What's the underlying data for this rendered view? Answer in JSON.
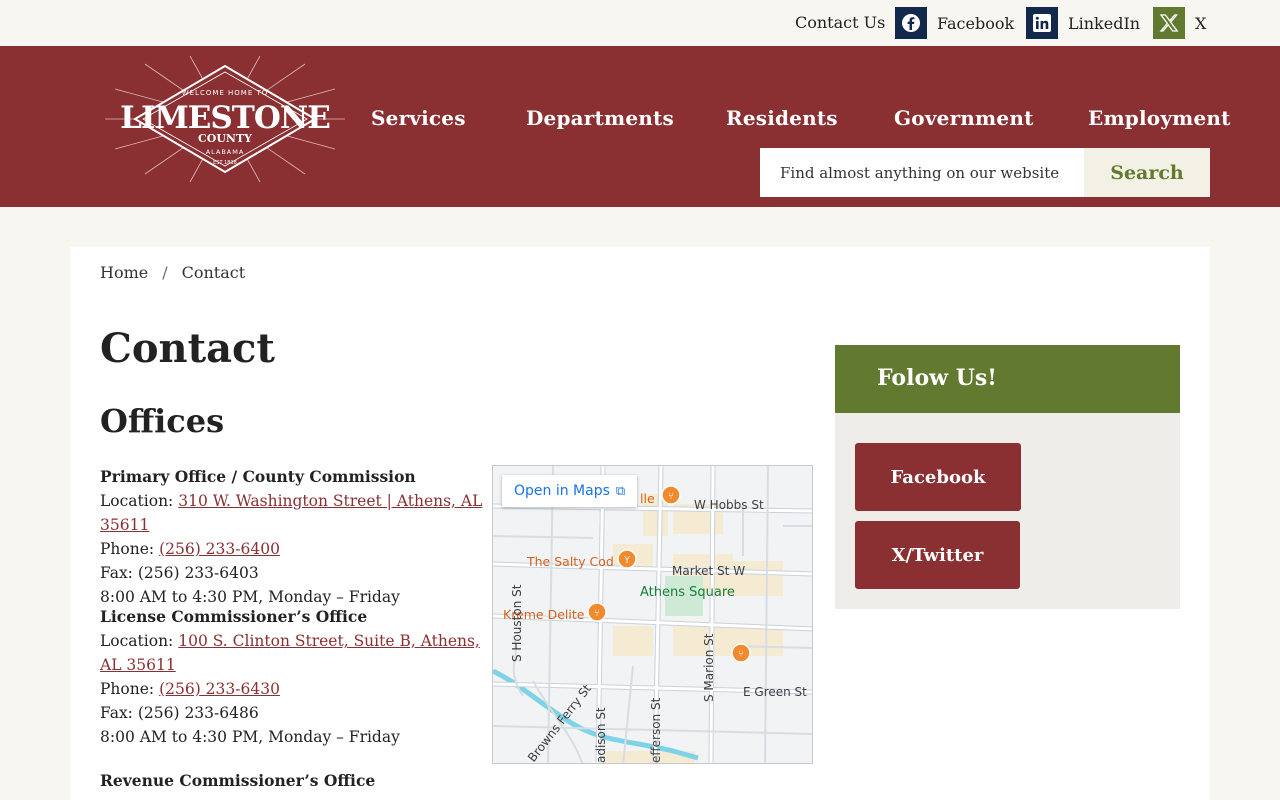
{
  "topbar": {
    "contact": "Contact Us",
    "social": [
      {
        "label": "Facebook",
        "icon": "facebook-icon"
      },
      {
        "label": "LinkedIn",
        "icon": "linkedin-icon"
      },
      {
        "label": "X",
        "icon": "x-icon"
      }
    ]
  },
  "logo": {
    "top_text": "WELCOME HOME TO",
    "name": "LIMESTONE",
    "county": "COUNTY",
    "state": "ALABAMA",
    "est": "EST 1818"
  },
  "nav": [
    "Services",
    "Departments",
    "Residents",
    "Government",
    "Employment"
  ],
  "search": {
    "placeholder": "Find almost anything on our website",
    "button": "Search"
  },
  "breadcrumb": {
    "home": "Home",
    "sep": "/",
    "current": "Contact"
  },
  "page": {
    "title": "Contact",
    "section": "Offices"
  },
  "offices": [
    {
      "name": "Primary Office / County Commission",
      "location_label": "Location:",
      "location": "310 W. Washington Street | Athens, AL 35611",
      "phone_label": "Phone:",
      "phone": "(256) 233-6400",
      "fax": "Fax: (256) 233-6403",
      "hours": "8:00 AM to 4:30 PM, Monday – Friday"
    },
    {
      "name": "License Commissioner’s Office",
      "location_label": "Location:",
      "location": "100 S. Clinton Street, Suite B, Athens, AL 35611",
      "phone_label": "Phone:",
      "phone": "(256) 233-6430",
      "fax": "Fax: (256) 233-6486",
      "hours": "8:00 AM to 4:30 PM, Monday – Friday"
    },
    {
      "name": "Revenue Commissioner’s Office"
    }
  ],
  "map": {
    "open_label": "Open in Maps",
    "pois": [
      "lle",
      "The Salty Cod",
      "Kreme Delite"
    ],
    "park": "Athens Square",
    "streets": [
      "W Hobbs St",
      "Market St W",
      "S Houston St",
      "S Marion St",
      "E Green St",
      "Browns Ferry St",
      "adison St",
      "efferson St"
    ],
    "colors": {
      "poi": "#d8611b",
      "park": "#188038",
      "water": "#7fd3e6",
      "link": "#1a73e8"
    }
  },
  "follow": {
    "title": "Folow Us!",
    "buttons": [
      "Facebook",
      "X/Twitter"
    ]
  },
  "colors": {
    "brand_red": "#8a2f32",
    "brand_green": "#617a2f",
    "navy": "#13294b"
  }
}
